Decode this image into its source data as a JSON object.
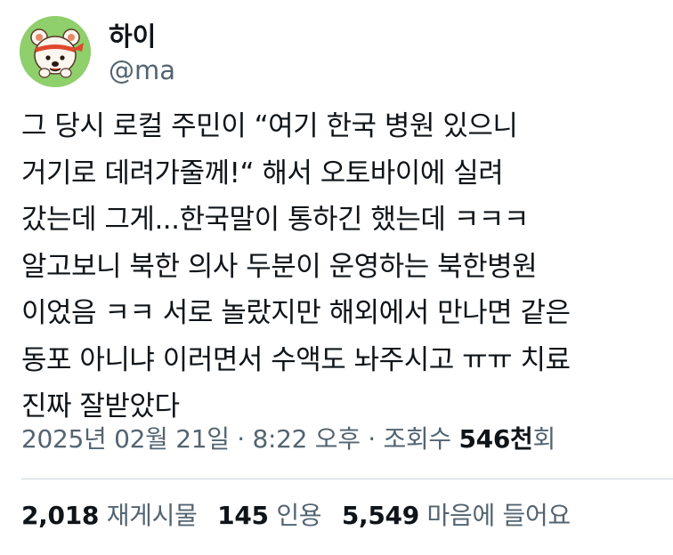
{
  "author": {
    "name": "하이",
    "handle": "@ma"
  },
  "tweet": {
    "lines": [
      "그 당시 로컬 주민이 “여기 한국 병원 있으니",
      "거기로 데려가줄께!“ 해서 오토바이에 실려",
      "갔는데 그게...한국말이 통하긴 했는데 ㅋㅋㅋ",
      "알고보니 북한 의사 두분이 운영하는 북한병원",
      "이었음 ㅋㅋ 서로 놀랐지만 해외에서 만나면 같은",
      "동포 아니냐 이러면서 수액도 놔주시고 ㅠㅠ 치료",
      "진짜 잘받았다"
    ]
  },
  "meta": {
    "timestamp": "2025년 02월 21일 · 8:22 오후 · 조회수 ",
    "views_count": "546천",
    "views_suffix": "회"
  },
  "stats": {
    "reposts_count": "2,018",
    "reposts_label": "재게시물",
    "quotes_count": "145",
    "quotes_label": "인용",
    "likes_count": "5,549",
    "likes_label": "마음에 들어요"
  },
  "colors": {
    "text_primary": "#0f1419",
    "text_secondary": "#536471",
    "avatar_bg": "#8fcf6c",
    "divider": "#cfd9de"
  }
}
